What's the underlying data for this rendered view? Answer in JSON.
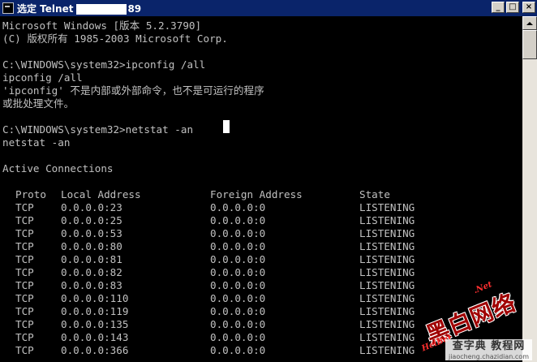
{
  "window": {
    "title_prefix": "选定 Telnet",
    "title_suffix": "89",
    "buttons": {
      "minimize": "_",
      "maximize": "□",
      "close": "×"
    }
  },
  "console": {
    "lines": [
      "Microsoft Windows [版本 5.2.3790]",
      "(C) 版权所有 1985-2003 Microsoft Corp.",
      "",
      "C:\\WINDOWS\\system32>ipconfig /all",
      "ipconfig /all",
      "'ipconfig' 不是内部或外部命令，也不是可运行的程序",
      "或批处理文件。",
      "",
      "C:\\WINDOWS\\system32>netstat -an",
      "netstat -an",
      "",
      "Active Connections",
      ""
    ],
    "table": {
      "headers": [
        "Proto",
        "Local Address",
        "Foreign Address",
        "State"
      ],
      "rows": [
        [
          "TCP",
          "0.0.0.0:23",
          "0.0.0.0:0",
          "LISTENING"
        ],
        [
          "TCP",
          "0.0.0.0:25",
          "0.0.0.0:0",
          "LISTENING"
        ],
        [
          "TCP",
          "0.0.0.0:53",
          "0.0.0.0:0",
          "LISTENING"
        ],
        [
          "TCP",
          "0.0.0.0:80",
          "0.0.0.0:0",
          "LISTENING"
        ],
        [
          "TCP",
          "0.0.0.0:81",
          "0.0.0.0:0",
          "LISTENING"
        ],
        [
          "TCP",
          "0.0.0.0:82",
          "0.0.0.0:0",
          "LISTENING"
        ],
        [
          "TCP",
          "0.0.0.0:83",
          "0.0.0.0:0",
          "LISTENING"
        ],
        [
          "TCP",
          "0.0.0.0:110",
          "0.0.0.0:0",
          "LISTENING"
        ],
        [
          "TCP",
          "0.0.0.0:119",
          "0.0.0.0:0",
          "LISTENING"
        ],
        [
          "TCP",
          "0.0.0.0:135",
          "0.0.0.0:0",
          "LISTENING"
        ],
        [
          "TCP",
          "0.0.0.0:143",
          "0.0.0.0:0",
          "LISTENING"
        ],
        [
          "TCP",
          "0.0.0.0:366",
          "0.0.0.0:0",
          "LISTENING"
        ]
      ]
    }
  },
  "watermark": {
    "main": "黑白网络",
    "sub": "HeiBai",
    "net": ".Net"
  },
  "site_mark": {
    "big": "查字典 教程网",
    "small": "jiaocheng.chazidian.com"
  },
  "colors": {
    "title_bar": "#0a246a",
    "console_bg": "#000000",
    "console_text": "#c0c0c0"
  },
  "icons": {
    "app": "console-icon",
    "scroll_up": "triangle-up-icon"
  }
}
